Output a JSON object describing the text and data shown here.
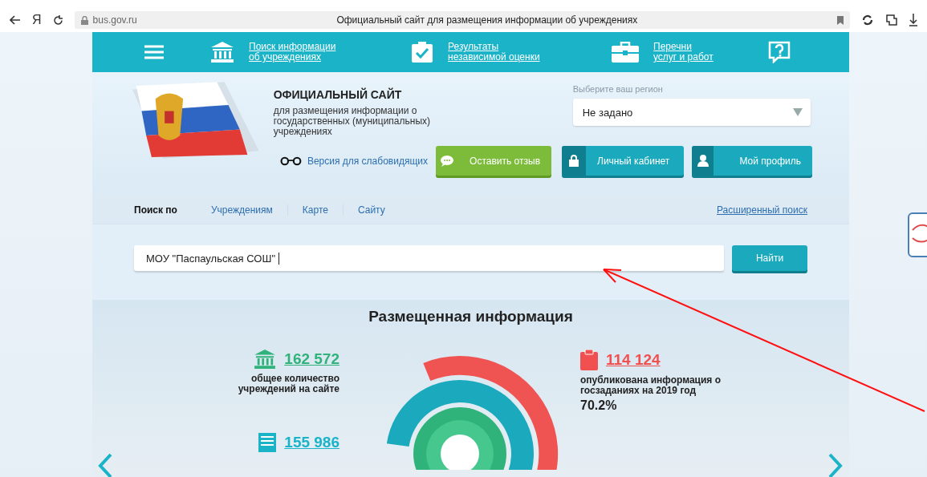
{
  "browser": {
    "logo": "Я",
    "url": "bus.gov.ru",
    "page_title": "Официальный сайт для размещения информации об учреждениях"
  },
  "nav": {
    "links": [
      {
        "kind": "building",
        "lines": [
          "Поиск информации",
          "об учреждениях"
        ]
      },
      {
        "kind": "check",
        "lines": [
          "Результаты",
          "независимой оценки"
        ]
      },
      {
        "kind": "briefcase",
        "lines": [
          "Перечни",
          "услуг и работ"
        ]
      }
    ]
  },
  "header": {
    "title": "ОФИЦИАЛЬНЫЙ САЙТ",
    "subtitle": "для размещения информации о государственных (муниципальных) учреждениях",
    "accessibility_link": "Версия для слабовидящих",
    "region_label": "Выберите ваш регион",
    "region_value": "Не задано",
    "buttons": [
      {
        "kind": "feedback",
        "label": "Оставить отзыв"
      },
      {
        "kind": "account",
        "label": "Личный кабинет"
      },
      {
        "kind": "profile",
        "label": "Мой профиль"
      }
    ]
  },
  "search": {
    "label": "Поиск по",
    "tabs": [
      "Учреждениям",
      "Карте",
      "Сайту"
    ],
    "advanced_link": "Расширенный поиск",
    "value": "МОУ \"Паспаульская СОШ\" ",
    "button": "Найти"
  },
  "stats": {
    "title": "Размещенная информация",
    "items": [
      {
        "kind": "institutions",
        "value": "162 572",
        "caption": "общее количество учреждений на сайте",
        "color": "#2fb37a"
      },
      {
        "kind": "tasks",
        "value": "114 124",
        "caption": "опубликована информация о госзаданиях на 2019 год",
        "percent": "70.2%",
        "color": "#f0504f"
      },
      {
        "kind": "documents",
        "value": "155 986",
        "color": "#1ab3c8"
      }
    ]
  }
}
